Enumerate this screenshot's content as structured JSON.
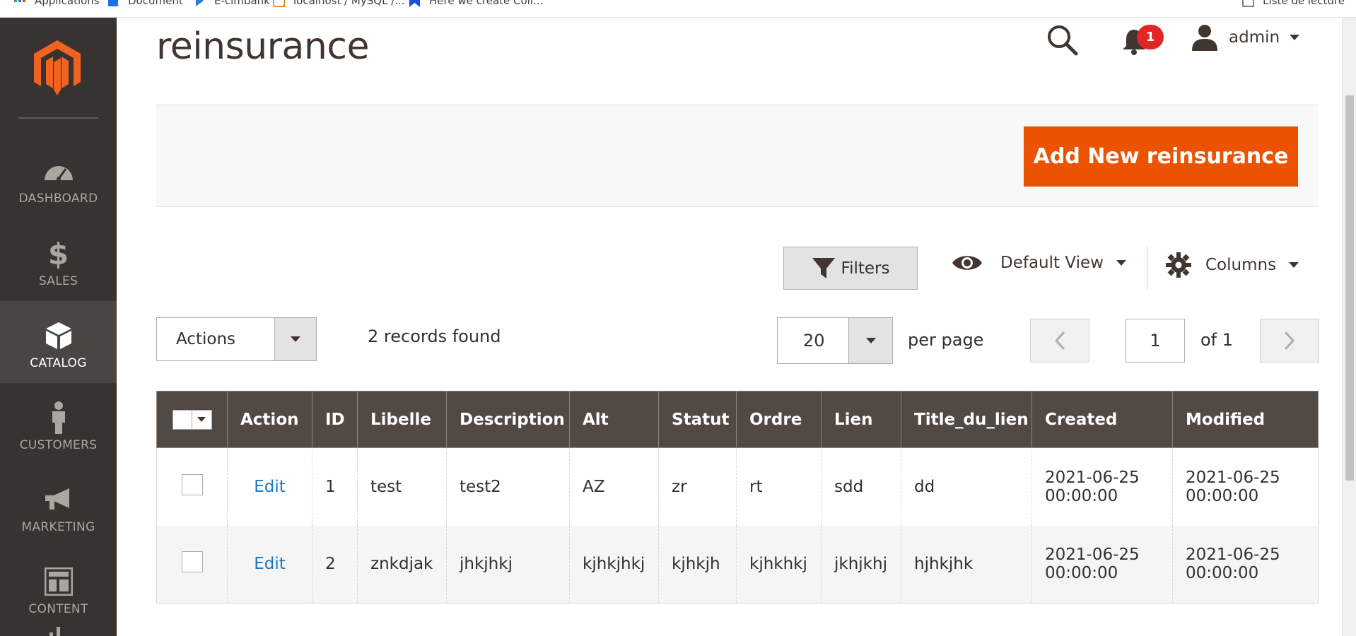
{
  "browser": {
    "bookmarks": [
      {
        "label": "Applications",
        "icon": "apps-grid-icon"
      },
      {
        "label": "Document",
        "icon": "document-icon"
      },
      {
        "label": "E-cimbank",
        "icon": "bookmark-icon"
      },
      {
        "label": "localhost / MySQL /...",
        "icon": "phpmyadmin-icon"
      },
      {
        "label": "Here we create Coll...",
        "icon": "bookmark-icon"
      }
    ],
    "reading_list": "Liste de lecture"
  },
  "sidebar": {
    "logo": "magento-logo",
    "items": [
      {
        "label": "DASHBOARD",
        "icon": "speedometer-icon",
        "active": false
      },
      {
        "label": "SALES",
        "icon": "dollar-icon",
        "active": false
      },
      {
        "label": "CATALOG",
        "icon": "box-icon",
        "active": true
      },
      {
        "label": "CUSTOMERS",
        "icon": "person-icon",
        "active": false
      },
      {
        "label": "MARKETING",
        "icon": "megaphone-icon",
        "active": false
      },
      {
        "label": "CONTENT",
        "icon": "layout-icon",
        "active": false
      }
    ]
  },
  "header": {
    "title": "reinsurance",
    "notifications_count": "1",
    "user_name": "admin"
  },
  "page_actions": {
    "add_button": "Add New reinsurance"
  },
  "grid_controls": {
    "filters_label": "Filters",
    "view_label": "Default View",
    "columns_label": "Columns",
    "actions_label": "Actions",
    "records_found": "2 records found",
    "per_page_value": "20",
    "per_page_label": "per page",
    "current_page": "1",
    "page_total": "of 1"
  },
  "table": {
    "columns": [
      "Action",
      "ID",
      "Libelle",
      "Description",
      "Alt",
      "Statut",
      "Ordre",
      "Lien",
      "Title_du_lien",
      "Created",
      "Modified"
    ],
    "rows": [
      {
        "action": "Edit",
        "id": "1",
        "libelle": "test",
        "description": "test2",
        "alt": "AZ",
        "statut": "zr",
        "ordre": "rt",
        "lien": "sdd",
        "title_du_lien": "dd",
        "created": "2021-06-25 00:00:00",
        "modified": "2021-06-25 00:00:00"
      },
      {
        "action": "Edit",
        "id": "2",
        "libelle": "znkdjak",
        "description": "jhkjhkj",
        "alt": "kjhkjhkj",
        "statut": "kjhkjh",
        "ordre": "kjhkhkj",
        "lien": "jkhjkhj",
        "title_du_lien": "hjhkjhk",
        "created": "2021-06-25 00:00:00",
        "modified": "2021-06-25 00:00:00"
      }
    ]
  },
  "colors": {
    "sidebar_bg": "#373330",
    "accent_orange": "#eb5202",
    "grid_header": "#514943",
    "link_blue": "#1979c3",
    "badge_red": "#e22626"
  }
}
